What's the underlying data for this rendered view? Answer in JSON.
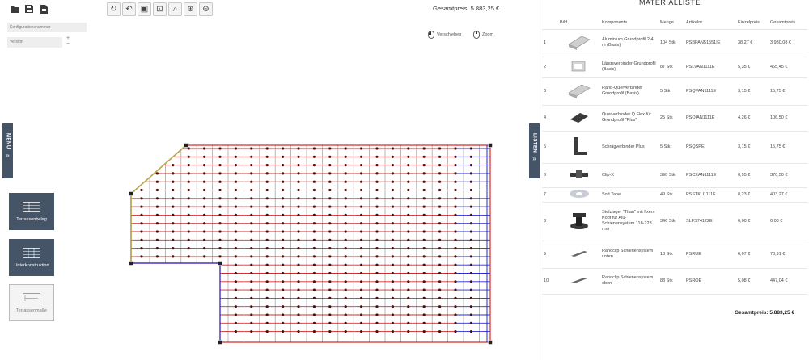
{
  "toolbar": {
    "left": [
      {
        "name": "open-folder-icon"
      },
      {
        "name": "save-icon"
      },
      {
        "name": "export-file-icon"
      }
    ],
    "center": [
      {
        "name": "refresh-icon",
        "glyph": "↻"
      },
      {
        "name": "undo-icon",
        "glyph": "↶"
      },
      {
        "name": "save-as-icon",
        "glyph": "▣"
      },
      {
        "name": "fit-view-icon",
        "glyph": "⊡"
      },
      {
        "name": "zoom-search-icon",
        "glyph": "⌕"
      },
      {
        "name": "zoom-in-icon",
        "glyph": "⊕"
      },
      {
        "name": "zoom-out-icon",
        "glyph": "⊖"
      }
    ]
  },
  "config": {
    "number_placeholder": "Konfigurationsnummer",
    "version_placeholder": "Version",
    "stepper_up": "+",
    "stepper_down": "−"
  },
  "canvas": {
    "total_label": "Gesamtpreis: 5.883,25 €",
    "legend_pan": "Verschieben",
    "legend_zoom": "Zoom"
  },
  "side_tabs": {
    "menu": "MENU",
    "listen": "LISTEN",
    "arrows": "»"
  },
  "tools": [
    {
      "label": "Terrassenbelag"
    },
    {
      "label": "Unterkonstruktion"
    },
    {
      "label": "Terrassenmaße"
    }
  ],
  "materials": {
    "title": "MATERIALLISTE",
    "columns": [
      "Bild",
      "Komponente",
      "Menge",
      "Artikelnr",
      "Einzelpreis",
      "Gesamtpreis"
    ],
    "rows": [
      {
        "nr": "1",
        "name": "Aluminium Grundprofil 2,4 m (Basis)",
        "qty": "104 Stk",
        "art": "PSBPAN51551IE",
        "unit": "38,27 €",
        "total": "3.980,08 €"
      },
      {
        "nr": "2",
        "name": "Längsverbinder Grundprofil (Basis)",
        "qty": "87 Stk",
        "art": "PSLVAN1111E",
        "unit": "5,35 €",
        "total": "465,45 €"
      },
      {
        "nr": "3",
        "name": "Rand-Querverbinder Grundprofil (Basis)",
        "qty": "5 Stk",
        "art": "PSQVAN1111E",
        "unit": "3,15 €",
        "total": "15,75 €"
      },
      {
        "nr": "4",
        "name": "Querverbinder Q Flex für Grundprofil \"Plus\"",
        "qty": "25 Stk",
        "art": "PSQIAN1111E",
        "unit": "4,26 €",
        "total": "106,50 €"
      },
      {
        "nr": "5",
        "name": "Schrägverbinder Plus",
        "qty": "5 Stk",
        "art": "PSQSPE",
        "unit": "3,15 €",
        "total": "15,75 €"
      },
      {
        "nr": "6",
        "name": "Clip-X",
        "qty": "390 Stk",
        "art": "PSCXAN1111E",
        "unit": "0,95 €",
        "total": "370,50 €"
      },
      {
        "nr": "7",
        "name": "Soft Tape",
        "qty": "49 Stk",
        "art": "PSSTKU1111E",
        "unit": "8,23 €",
        "total": "403,27 €"
      },
      {
        "nr": "8",
        "name": "Stelzlager \"Titan\" mit fixem Kopf für Alu-Schienensystem 118-223 mm",
        "qty": "346 Stk",
        "art": "SLFS74122E",
        "unit": "0,00 €",
        "total": "0,00 €"
      },
      {
        "nr": "9",
        "name": "Randclip Schienensystem unten",
        "qty": "13 Stk",
        "art": "PSRUE",
        "unit": "6,07 €",
        "total": "78,91 €"
      },
      {
        "nr": "10",
        "name": "Randclip Schienensystem oben",
        "qty": "88 Stk",
        "art": "PSROE",
        "unit": "5,08 €",
        "total": "447,04 €"
      }
    ],
    "total_label": "Gesamtpreis: 5.883,25 €"
  },
  "colors": {
    "sidebar": "#465468",
    "red": "#d42a2a",
    "blue": "#2a2ad4",
    "gray": "#9a9a9a",
    "olive": "#b8a64a",
    "node": "#4a1010"
  }
}
